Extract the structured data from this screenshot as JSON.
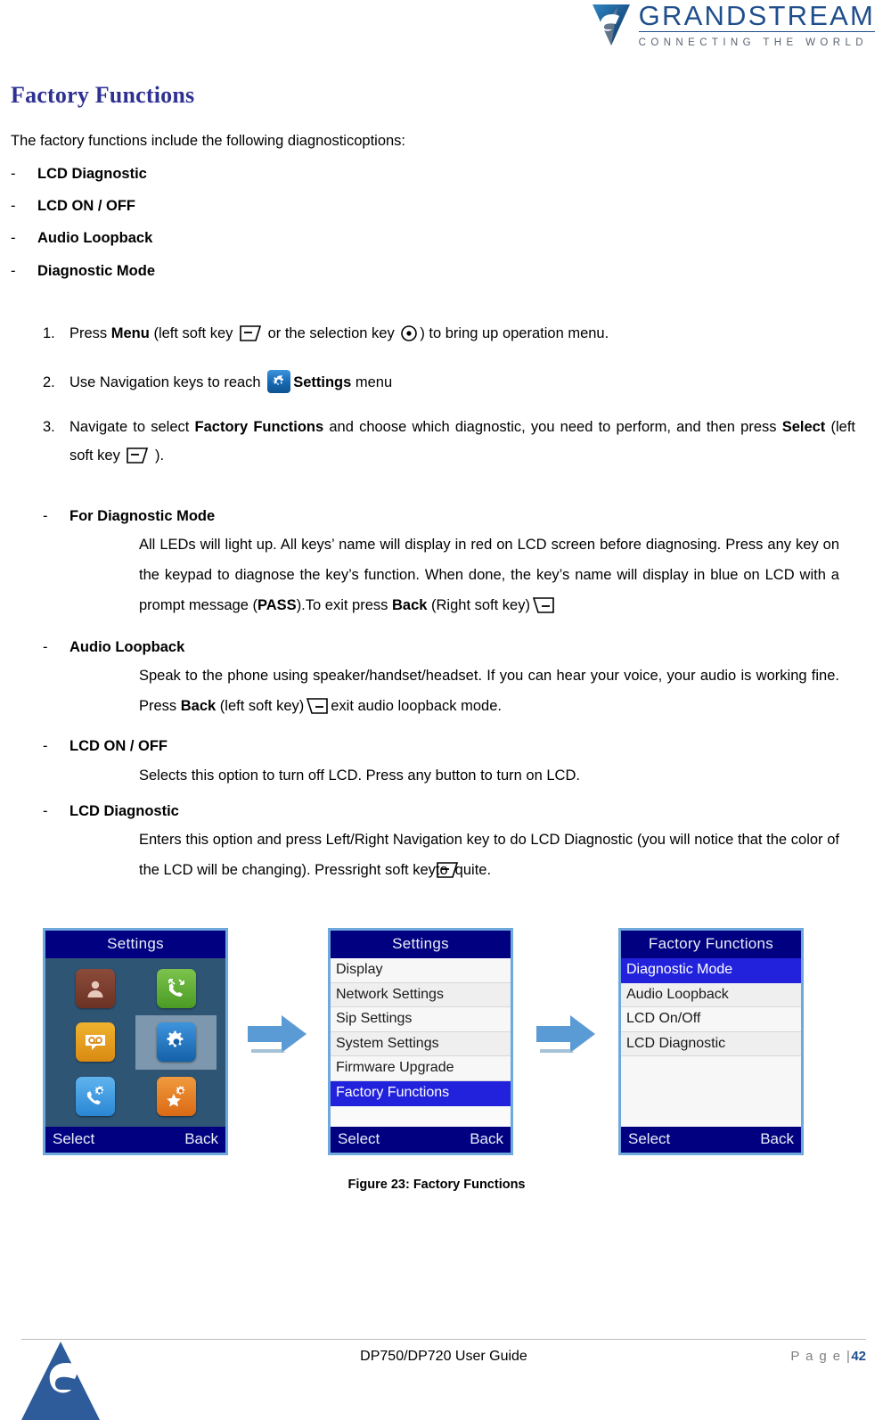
{
  "header": {
    "logo_word": "GRANDSTREAM",
    "logo_tagline": "CONNECTING THE WORLD",
    "logo_icon": "grandstream-logo-icon"
  },
  "section": {
    "title": "Factory Functions",
    "intro": "The factory functions include the following diagnosticoptions:",
    "options": [
      {
        "dash": "-",
        "label": "LCD Diagnostic"
      },
      {
        "dash": "-",
        "label": "LCD ON / OFF"
      },
      {
        "dash": "-",
        "label": "Audio Loopback"
      },
      {
        "dash": "-",
        "label": "Diagnostic Mode"
      }
    ]
  },
  "steps": [
    {
      "num": "1.",
      "part1": "Press ",
      "bold1": "Menu",
      "part2": " (left soft key ",
      "icon1": "left-soft-key-icon",
      "part3": " or the selection key ",
      "icon2": "selection-key-icon",
      "part4": ") to bring up operation menu."
    },
    {
      "num": "2.",
      "part1": "Use Navigation keys to reach ",
      "icon1": "settings-gear-icon",
      "bold1": "Settings",
      "part2": " menu"
    },
    {
      "num": "3.",
      "part1": "Navigate to select ",
      "bold1": "Factory Functions",
      "part2": " and choose which diagnostic, you need to perform, and then press ",
      "bold2": "Select",
      "part3": " (left soft key ",
      "icon1": "left-soft-key-icon",
      "part4": " )."
    }
  ],
  "details": [
    {
      "dash": "-",
      "heading": "For Diagnostic Mode",
      "body_1": "All LEDs will light up. All keys’ name will display in red on LCD screen before diagnosing. Press any key on the keypad to diagnose the key’s function. When done, the key’s name will display in blue on LCD with a prompt message (",
      "bold_1": "PASS",
      "body_2": ").To exit press ",
      "bold_2": "Back",
      "body_3": " (Right soft key)",
      "icon": "right-soft-key-icon",
      "body_4": ""
    },
    {
      "dash": "-",
      "heading": "Audio Loopback",
      "body_1": "Speak to the phone using speaker/handset/headset. If you can hear your voice, your audio is working fine. Press ",
      "bold_1": "Back",
      "body_2": " (left soft key)",
      "icon": "right-soft-key-icon",
      "body_3": "exit audio loopback mode."
    },
    {
      "dash": "-",
      "heading": "LCD ON / OFF",
      "body_1": "Selects this option to turn off LCD. Press any button to turn on LCD."
    },
    {
      "dash": "-",
      "heading": "LCD Diagnostic",
      "body_1": "Enters this option and press Left/Right Navigation key to do LCD Diagnostic (you will notice that the color of the LCD will be changing). Pressright soft keyto",
      "icon": "left-soft-key-icon",
      "body_2": "quite."
    }
  ],
  "figure": {
    "caption": "Figure 23: Factory Functions",
    "arrow_icon": "right-arrow-icon",
    "screens": [
      {
        "name": "settings-icon-grid-screen",
        "title": "Settings",
        "type": "grid",
        "icons": [
          {
            "name": "contacts-icon",
            "glyph": "👤",
            "cls": "ic-contacts",
            "selected": false
          },
          {
            "name": "call-history-icon",
            "glyph": "↙",
            "cls": "ic-calls",
            "selected": false
          },
          {
            "name": "voicemail-icon",
            "glyph": "◉◉",
            "cls": "ic-voicemail",
            "selected": false
          },
          {
            "name": "settings-icon",
            "glyph": "⚙",
            "cls": "ic-settings",
            "selected": true
          },
          {
            "name": "call-settings-icon",
            "glyph": "✆",
            "cls": "ic-callset",
            "selected": false
          },
          {
            "name": "shortcut-icon",
            "glyph": "★",
            "cls": "ic-shortcut",
            "selected": false
          }
        ],
        "softkey_left": "Select",
        "softkey_right": "Back"
      },
      {
        "name": "settings-list-screen",
        "title": "Settings",
        "type": "list",
        "rows": [
          {
            "label": "Display",
            "highlight": false
          },
          {
            "label": "Network Settings",
            "highlight": false
          },
          {
            "label": "Sip Settings",
            "highlight": false
          },
          {
            "label": "System Settings",
            "highlight": false
          },
          {
            "label": "Firmware Upgrade",
            "highlight": false
          },
          {
            "label": "Factory Functions",
            "highlight": true
          }
        ],
        "softkey_left": "Select",
        "softkey_right": "Back"
      },
      {
        "name": "factory-functions-list-screen",
        "title": "Factory Functions",
        "type": "list",
        "rows": [
          {
            "label": "Diagnostic Mode",
            "highlight": true
          },
          {
            "label": "Audio Loopback",
            "highlight": false
          },
          {
            "label": "LCD On/Off",
            "highlight": false
          },
          {
            "label": "LCD Diagnostic",
            "highlight": false
          }
        ],
        "softkey_left": "Select",
        "softkey_right": "Back"
      }
    ]
  },
  "footer": {
    "document": "DP750/DP720 User Guide",
    "page_label": "P a g e |",
    "page_number": "42",
    "logo_icon": "grandstream-triangle-logo-icon"
  },
  "colors": {
    "brand_blue": "#1F4E8C",
    "title_purple": "#2E3192",
    "lcd_title_bg": "#000080",
    "lcd_highlight": "#2222DD",
    "arrow_blue": "#5B9BD5"
  }
}
